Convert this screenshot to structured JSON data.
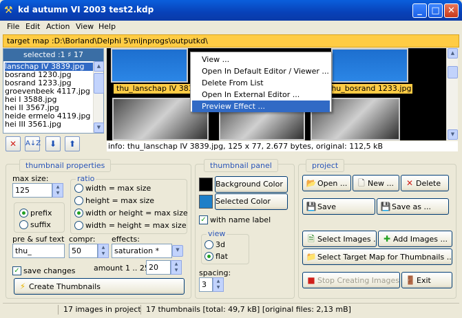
{
  "window": {
    "title": "kd autumn VI 2003 test2.kdp",
    "minimize": "_",
    "maximize": "□",
    "close": "✕"
  },
  "menu": [
    "File",
    "Edit",
    "Action",
    "View",
    "Help"
  ],
  "target_map": "target map :D:\\Borland\\Delphi 5\\mijnprogs\\outputkd\\",
  "file_list": {
    "header": "selected :1 ♯ 17",
    "items": [
      "lanschap IV 3839.jpg",
      "bosrand 1230.jpg",
      "bosrand 1233.jpg",
      "groevenbeek 4117.jpg",
      "hei I 3588.jpg",
      "hei II 3567.jpg",
      "heide ermelo 4119.jpg",
      "hei III 3561.jpg"
    ],
    "selected_index": 0
  },
  "preview": {
    "labels": [
      "thu_lanschap IV 3839.jpg",
      "thu_bosrand 1233.jpg"
    ]
  },
  "context_menu": {
    "items": [
      "View ...",
      "Open In Default Editor / Viewer ...",
      "Delete From List",
      "Open In External Editor ...",
      "Preview Effect ..."
    ],
    "highlighted_index": 4
  },
  "info": "info:  thu_lanschap IV 3839.jpg,  125 x 77,  2.677 bytes,  original: 112,5 kB",
  "thumbnail_properties": {
    "title": "thumbnail properties",
    "max_size_label": "max size:",
    "max_size_value": "125",
    "ratio_label": "ratio",
    "ratio_options": [
      "width = max size",
      "height = max size",
      "width or height = max size",
      "width = height = max size"
    ],
    "ratio_selected": 2,
    "prefix_label": "prefix",
    "suffix_label": "suffix",
    "prefix_suffix_selected": "prefix",
    "pre_suf_label": "pre & suf text",
    "pre_suf_value": "thu_",
    "compr_label": "compr:",
    "compr_value": "50",
    "effects_label": "effects:",
    "effects_value": "saturation *",
    "save_changes_label": "save changes",
    "save_changes_checked": true,
    "amount_label": "amount 1 .. 25",
    "amount_value": "20",
    "create_button": "Create Thumbnails"
  },
  "thumbnail_panel": {
    "title": "thumbnail panel",
    "background_color_button": "Background Color",
    "selected_color_button": "Selected Color",
    "background_color": "#000000",
    "selected_color": "#1e7fc8",
    "with_name_label": "with name label",
    "with_name_checked": true,
    "view_label": "view",
    "view_options": [
      "3d",
      "flat"
    ],
    "view_selected": 1,
    "spacing_label": "spacing:",
    "spacing_value": "3"
  },
  "project": {
    "title": "project",
    "open": "Open ...",
    "new": "New ...",
    "delete": "Delete",
    "save": "Save",
    "save_as": "Save as ...",
    "select_images": "Select Images ...",
    "add_images": "Add Images ...",
    "select_target": "Select Target Map for Thumbnails ...",
    "stop": "Stop Creating Images",
    "exit": "Exit"
  },
  "status": {
    "images": "17 images in project",
    "thumbnails": "17 thumbnails [total: 49,7 kB] [original files: 2,13 mB]"
  }
}
